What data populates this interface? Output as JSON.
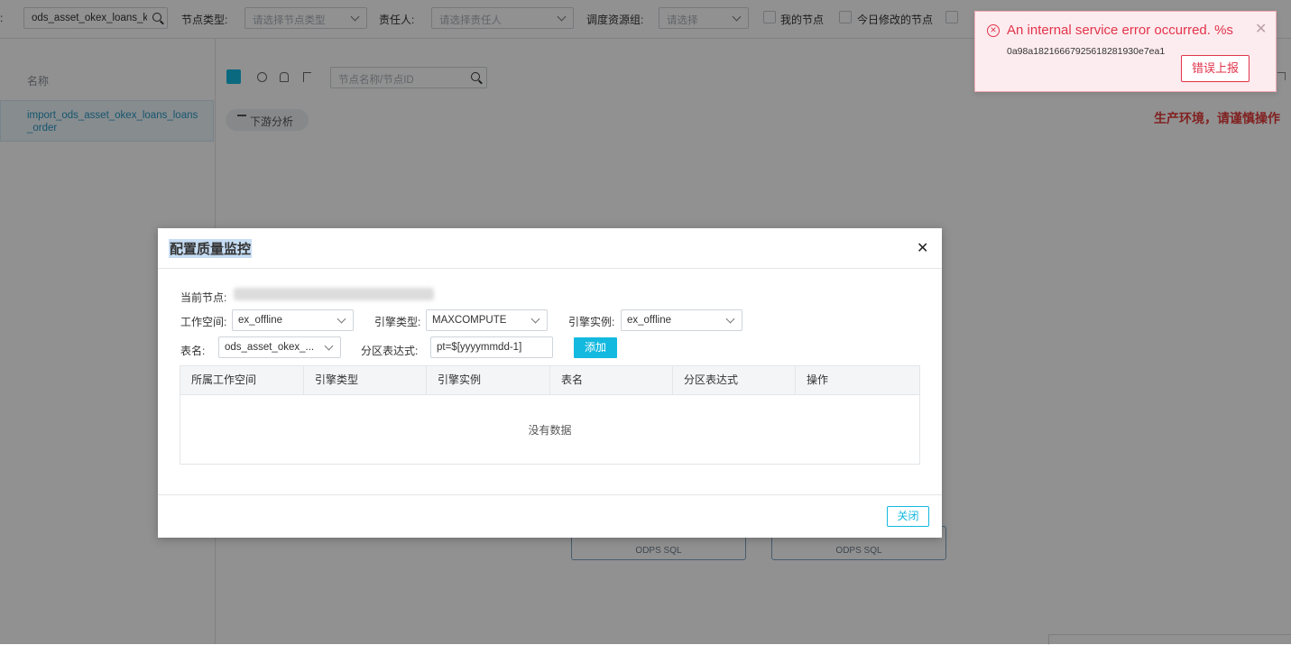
{
  "filterbar": {
    "search_value": "ods_asset_okex_loans_k",
    "node_type_label": "节点类型:",
    "node_type_placeholder": "请选择节点类型",
    "owner_label": "责任人:",
    "owner_placeholder": "请选择责任人",
    "resource_group_label": "调度资源组:",
    "resource_group_placeholder": "请选择",
    "my_nodes_label": "我的节点",
    "modified_today_label": "今日修改的节点"
  },
  "left_panel": {
    "header": "名称",
    "items": [
      {
        "label": "import_ods_asset_okex_loans_loans_order"
      }
    ]
  },
  "canvas": {
    "search_placeholder": "节点名称/节点ID",
    "downstream_label": "下游分析",
    "prod_warning": "生产环境，请谨慎操作",
    "odps_nodes": [
      "ODPS SQL",
      "ODPS SQL"
    ]
  },
  "modal": {
    "title": "配置质量监控",
    "current_node_label": "当前节点:",
    "workspace_label": "工作空间:",
    "workspace_value": "ex_offline",
    "engine_type_label": "引擎类型:",
    "engine_type_value": "MAXCOMPUTE",
    "engine_instance_label": "引擎实例:",
    "engine_instance_value": "ex_offline",
    "table_label": "表名:",
    "table_value": "ods_asset_okex_...",
    "partition_label": "分区表达式:",
    "partition_value": "pt=$[yyyymmdd-1]",
    "add_label": "添加",
    "columns": [
      "所属工作空间",
      "引擎类型",
      "引擎实例",
      "表名",
      "分区表达式",
      "操作"
    ],
    "empty_text": "没有数据",
    "close_label": "关闭"
  },
  "toast": {
    "message": "An internal service error occurred. %s",
    "request_id": "0a98a18216667925618281930e7ea1",
    "report_label": "错误上报"
  },
  "colors": {
    "accent": "#13b9df",
    "error": "#e1344b",
    "warning_text": "#e33b3b",
    "link": "#2897c2"
  }
}
